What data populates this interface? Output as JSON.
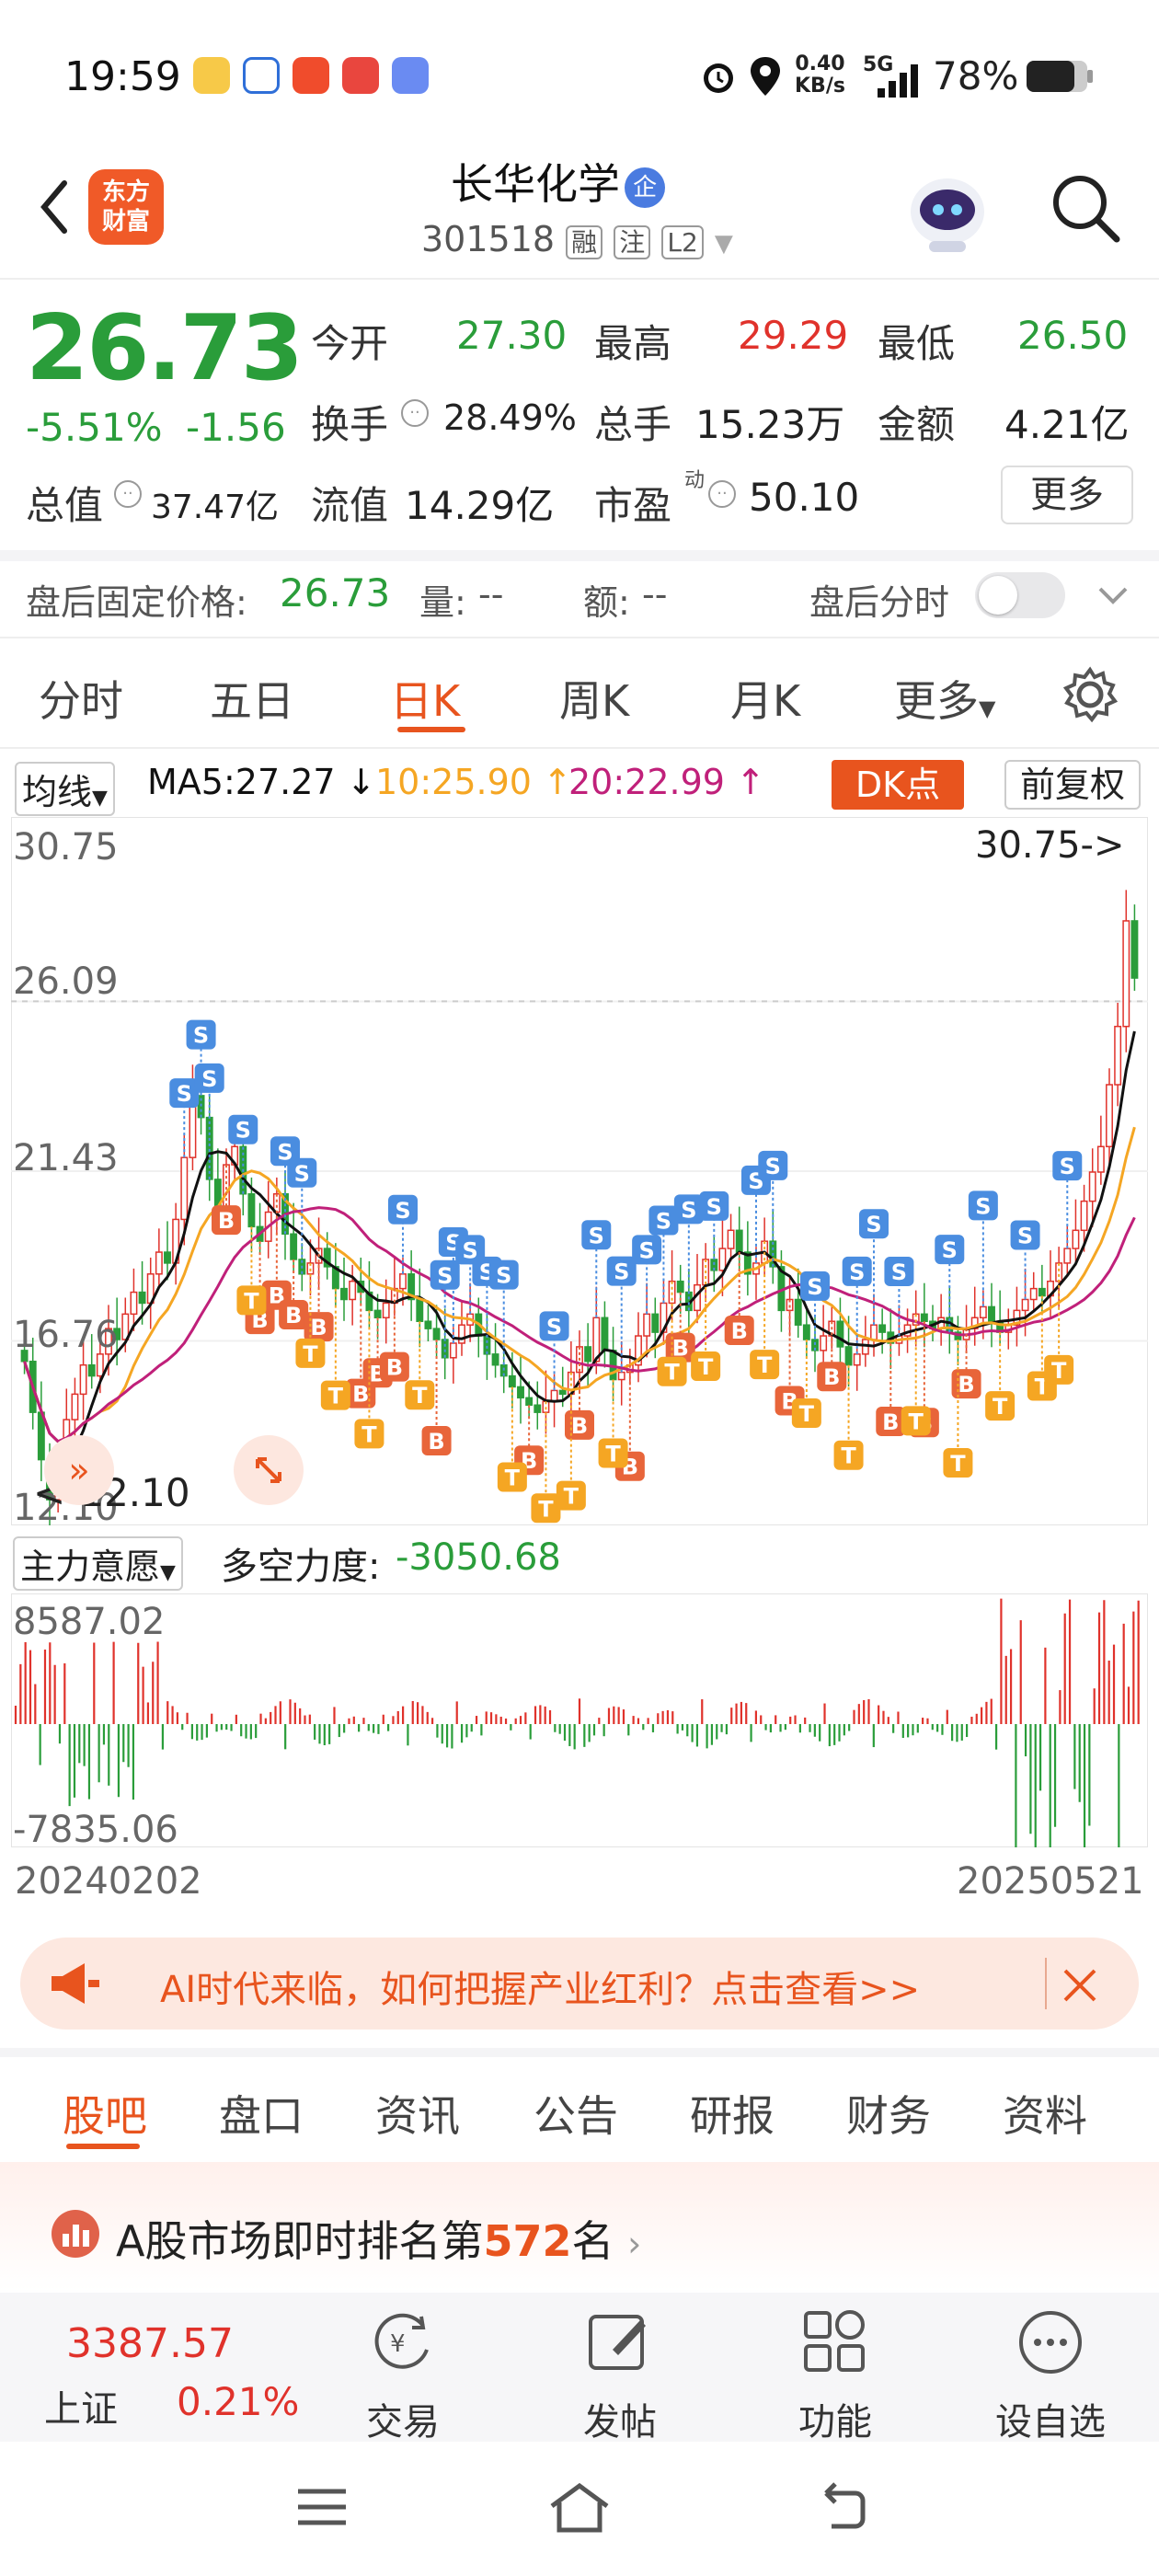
{
  "status_bar": {
    "time": "19:59",
    "net_speed_top": "0.40",
    "net_speed_unit": "KB/s",
    "network": "5G",
    "battery": "78%"
  },
  "header": {
    "title": "长华化学",
    "badge": "企",
    "code": "301518",
    "tags": [
      "融",
      "注",
      "L2"
    ],
    "logo_line1": "东方",
    "logo_line2": "财富"
  },
  "quote": {
    "price": "26.73",
    "change_pct": "-5.51%",
    "change_abs": "-1.56",
    "open_label": "今开",
    "open": "27.30",
    "high_label": "最高",
    "high": "29.29",
    "low_label": "最低",
    "low": "26.50",
    "turnover_label": "换手",
    "turnover": "28.49%",
    "volume_label": "总手",
    "volume": "15.23万",
    "amount_label": "金额",
    "amount": "4.21亿",
    "mktcap_label": "总值",
    "mktcap": "37.47亿",
    "float_label": "流值",
    "float": "14.29亿",
    "pe_label": "市盈",
    "pe_sup": "动",
    "pe": "50.10",
    "more": "更多"
  },
  "after_hours": {
    "price_label": "盘后固定价格:",
    "price": "26.73",
    "vol_label": "量:",
    "vol": "--",
    "amt_label": "额:",
    "amt": "--",
    "toggle_label": "盘后分时"
  },
  "kline_tabs": [
    "分时",
    "五日",
    "日K",
    "周K",
    "月K",
    "更多"
  ],
  "indicators": {
    "ma_select": "均线",
    "ma5": "MA5:27.27 ↓",
    "ma10": "10:25.90 ↑",
    "ma20": "20:22.99 ↑",
    "dk": "DK点",
    "fq": "前复权"
  },
  "colors": {
    "accent": "#e8541e",
    "up": "#e0322b",
    "down": "#2a9d3a",
    "ma5": "#111111",
    "ma10": "#f5a623",
    "ma20": "#c0207a",
    "signal_s": "#4a8de0",
    "signal_b": "#e8653a",
    "signal_t": "#f5a623"
  },
  "chart_axis": {
    "y_labels": [
      "30.75",
      "26.09",
      "21.43",
      "16.76",
      "12.10"
    ],
    "max_marker": "30.75->",
    "min_marker": "<-12.10"
  },
  "chart_data": {
    "type": "candlestick",
    "ylim": [
      12.1,
      30.75
    ],
    "close": [
      16.2,
      14.8,
      13.5,
      12.4,
      13.1,
      14.6,
      15.3,
      16.1,
      15.8,
      16.4,
      17.1,
      16.8,
      17.5,
      18.1,
      17.8,
      18.6,
      19.2,
      18.9,
      20.1,
      21.8,
      23.5,
      22.9,
      21.2,
      20.4,
      21.6,
      22.1,
      20.8,
      19.9,
      19.5,
      20.3,
      20.8,
      19.7,
      19.0,
      18.6,
      18.9,
      19.3,
      18.8,
      18.2,
      17.9,
      18.4,
      18.1,
      17.6,
      17.4,
      17.8,
      18.2,
      18.6,
      17.9,
      17.3,
      17.1,
      16.8,
      16.3,
      16.7,
      17.2,
      17.5,
      16.9,
      16.4,
      16.1,
      15.8,
      15.5,
      15.2,
      15.0,
      14.8,
      15.1,
      15.4,
      15.3,
      15.9,
      16.6,
      16.2,
      17.4,
      16.5,
      15.7,
      15.9,
      16.1,
      16.9,
      17.5,
      17.0,
      17.8,
      18.4,
      18.1,
      17.6,
      18.3,
      19.0,
      18.7,
      19.3,
      19.8,
      19.2,
      18.6,
      18.9,
      19.5,
      18.8,
      17.6,
      17.9,
      17.2,
      16.8,
      16.5,
      16.9,
      17.3,
      16.6,
      16.1,
      16.4,
      16.8,
      17.2,
      17.0,
      16.7,
      16.9,
      17.2,
      17.5,
      17.3,
      17.1,
      17.4,
      17.0,
      16.8,
      17.1,
      17.4,
      17.7,
      17.3,
      17.0,
      17.2,
      17.6,
      17.9,
      18.2,
      18.0,
      18.4,
      18.9,
      19.3,
      19.8,
      20.6,
      21.4,
      22.1,
      23.8,
      25.4,
      28.3,
      26.73
    ]
  },
  "sub_indicator": {
    "select": "主力意愿",
    "label": "多空力度:",
    "value": "-3050.68",
    "max": "8587.02",
    "min": "-7835.06",
    "date_start": "20240202",
    "date_end": "20250521"
  },
  "ad": {
    "text": "AI时代来临，如何把握产业红利？点击查看>>"
  },
  "section_tabs": [
    "股吧",
    "盘口",
    "资讯",
    "公告",
    "研报",
    "财务",
    "资料"
  ],
  "rank": {
    "prefix": "A股市场即时排名第",
    "num": "572",
    "suffix": "名"
  },
  "bottom_nav": {
    "index_value": "3387.57",
    "index_name": "上证",
    "index_change": "0.21%",
    "items": [
      "交易",
      "发帖",
      "功能",
      "设自选"
    ]
  }
}
